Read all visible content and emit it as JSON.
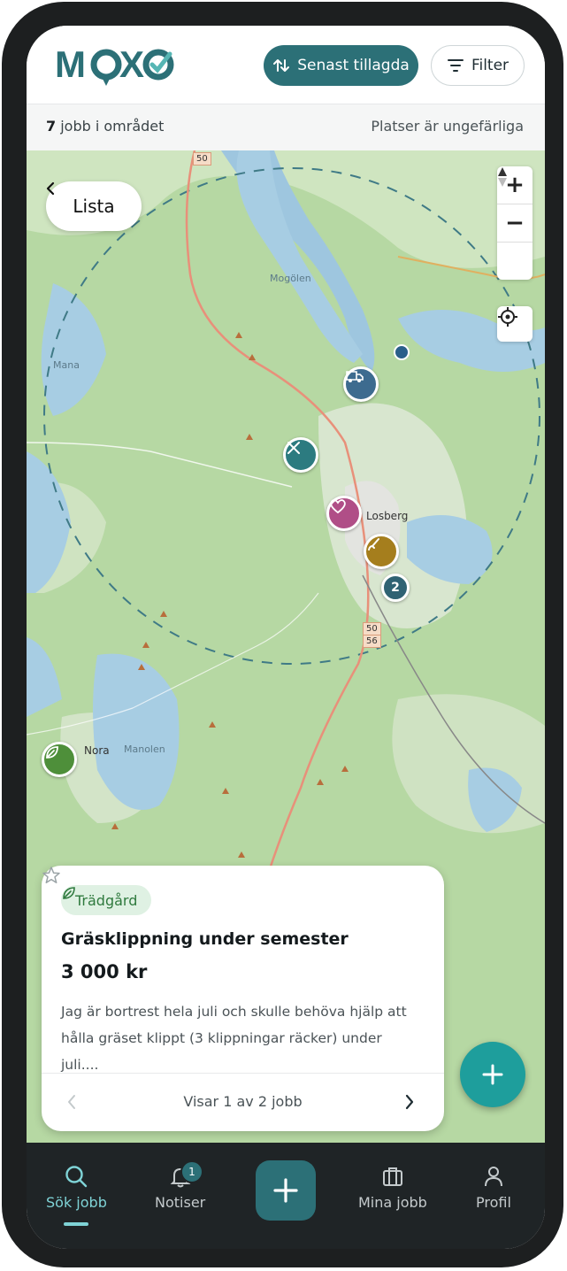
{
  "header": {
    "logo_text": "MOXO",
    "sort_label": "Senast tillagda",
    "filter_label": "Filter"
  },
  "subbar": {
    "count": "7",
    "count_suffix": " jobb i området",
    "note": "Platser är ungefärliga"
  },
  "map": {
    "list_button": "Lista",
    "zoom_in": "+",
    "zoom_out": "−",
    "places": [
      "Mogölen",
      "Losberg",
      "Nora",
      "Manolen",
      "Mana"
    ],
    "road_shields": [
      "50",
      "50",
      "56"
    ],
    "cluster_count": "2",
    "pins": [
      {
        "icon": "truck-icon",
        "color": "#3d6b8f"
      },
      {
        "icon": "tools-icon",
        "color": "#2c7b80"
      },
      {
        "icon": "heart-icon",
        "color": "#b04e87"
      },
      {
        "icon": "brush-icon",
        "color": "#a57e1d"
      },
      {
        "icon": "leaf-icon",
        "color": "#4e8f3a"
      }
    ]
  },
  "card": {
    "category": "Trädgård",
    "title": "Gräsklippning under semester",
    "price": "3 000 kr",
    "description": "Jag är bortrest hela juli och skulle behöva hjälp att hålla gräset klippt (3 klippningar räcker) under juli....",
    "pager": "Visar 1 av 2 jobb"
  },
  "nav": {
    "items": [
      {
        "label": "Sök jobb"
      },
      {
        "label": "Notiser"
      },
      {
        "label": "Mina jobb"
      },
      {
        "label": "Profil"
      }
    ],
    "notification_badge": "1"
  },
  "colors": {
    "brand": "#2c7077",
    "accent": "#1e9e9c",
    "nav_active": "#7fd3d6"
  }
}
